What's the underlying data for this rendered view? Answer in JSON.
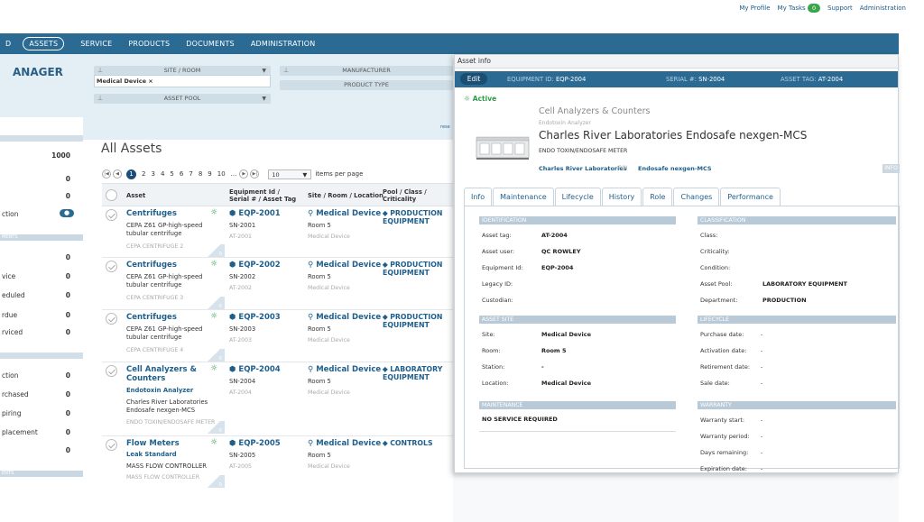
{
  "top_links": {
    "my_profile": "My Profile",
    "my_tasks": "My Tasks",
    "tasks_count": "0",
    "support": "Support",
    "administration": "Administration"
  },
  "nav": {
    "partial": "D",
    "assets": "ASSETS",
    "service": "SERVICE",
    "products": "PRODUCTS",
    "documents": "DOCUMENTS",
    "administration": "ADMINISTRATION"
  },
  "sidebar": {
    "brand": "ANAGER",
    "total": "1000",
    "rows": [
      {
        "label": "",
        "count": "0"
      },
      {
        "label": "",
        "count": "0"
      },
      {
        "label": "ction",
        "count": ""
      },
      {
        "label": "",
        "count": "0"
      },
      {
        "label": "vice",
        "count": "0"
      },
      {
        "label": "eduled",
        "count": "0"
      },
      {
        "label": "rdue",
        "count": "0"
      },
      {
        "label": "rviced",
        "count": "0"
      },
      {
        "label": "ction",
        "count": "0"
      },
      {
        "label": "rchased",
        "count": "0"
      },
      {
        "label": "piring",
        "count": "0"
      },
      {
        "label": "placement",
        "count": "0"
      },
      {
        "label": "",
        "count": "0"
      }
    ],
    "section1": "MENTS",
    "section2": "ENTS"
  },
  "filters": {
    "site_room": "SITE / ROOM",
    "site_room_value": "Medical Device ×",
    "manufacturer": "MANUFACTURER",
    "product_type": "PRODUCT TYPE",
    "asset_pool": "ASSET POOL",
    "partial": "rese"
  },
  "page_title": "All Assets",
  "pager": {
    "pages": [
      "2",
      "3",
      "4",
      "5",
      "6",
      "7",
      "8",
      "9",
      "10",
      "..."
    ],
    "current": "1",
    "per_page": "10",
    "items_label": "items per page"
  },
  "table": {
    "headers": {
      "asset": "Asset",
      "eq": "Equipment Id / Serial # / Asset Tag",
      "site": "Site / Room / Location",
      "pool": "Pool / Class / Criticality"
    },
    "rows": [
      {
        "name": "Centrifuges",
        "desc": "CEPA Z61 GP-high-speed tubular centrifuge",
        "sub_blue": "",
        "desc2": "",
        "grey": "CEPA CENTRIFUGE 2",
        "corner": "0",
        "eq": "EQP-2001",
        "sn": "SN-2001",
        "at": "AT-2001",
        "site": "Medical Device",
        "room": "Room 5",
        "loc": "Medical Device",
        "pool": "PRODUCTION EQUIPMENT"
      },
      {
        "name": "Centrifuges",
        "desc": "CEPA Z61 GP-high-speed tubular centrifuge",
        "sub_blue": "",
        "desc2": "",
        "grey": "CEPA CENTRIFUGE 3",
        "corner": "0",
        "eq": "EQP-2002",
        "sn": "SN-2002",
        "at": "AT-2002",
        "site": "Medical Device",
        "room": "Room 5",
        "loc": "Medical Device",
        "pool": "PRODUCTION EQUIPMENT"
      },
      {
        "name": "Centrifuges",
        "desc": "CEPA Z61 GP-high-speed tubular centrifuge",
        "sub_blue": "",
        "desc2": "",
        "grey": "CEPA CENTRIFUGE 4",
        "corner": "0",
        "eq": "EQP-2003",
        "sn": "SN-2003",
        "at": "AT-2003",
        "site": "Medical Device",
        "room": "Room 5",
        "loc": "Medical Device",
        "pool": "PRODUCTION EQUIPMENT"
      },
      {
        "name": "Cell Analyzers & Counters",
        "desc": "",
        "sub_blue": "Endotoxin Analyzer",
        "desc2": "Charles River Laboratories Endosafe nexgen-MCS",
        "grey": "ENDO TOXIN/ENDOSAFE METER",
        "corner": "0",
        "eq": "EQP-2004",
        "sn": "SN-2004",
        "at": "AT-2004",
        "site": "Medical Device",
        "room": "Room 5",
        "loc": "Medical Device",
        "pool": "LABORATORY EQUIPMENT"
      },
      {
        "name": "Flow Meters",
        "desc": "",
        "sub_blue": "Leak Standard",
        "desc2": "MASS FLOW CONTROLLER",
        "grey": "MASS FLOW CONTROLLER",
        "corner": "0",
        "eq": "EQP-2005",
        "sn": "SN-2005",
        "at": "AT-2005",
        "site": "Medical Device",
        "room": "Room 5",
        "loc": "Medical Device",
        "pool": "CONTROLS"
      }
    ]
  },
  "modal": {
    "title": "Asset info",
    "edit": "Edit",
    "equipment_id_label": "EQUIPMENT ID:",
    "equipment_id": "EQP-2004",
    "serial_label": "SERIAL #:",
    "serial": "SN-2004",
    "asset_tag_label": "ASSET TAG:",
    "asset_tag": "AT-2004",
    "status": "Active",
    "category": "Cell Analyzers & Counters",
    "subcategory": "Endotoxin Analyzer",
    "model": "Charles River Laboratories Endosafe nexgen-MCS",
    "model_type": "ENDO TOXIN/ENDOSAFE METER",
    "manufacturer": "Charles River Laboratories",
    "pn_label": "P/N",
    "pn_value": "Endosafe nexgen-MCS",
    "info_btn": "INFO",
    "tabs": [
      "Info",
      "Maintenance",
      "Lifecycle",
      "History",
      "Role",
      "Changes",
      "Performance"
    ],
    "identification": {
      "head": "IDENTIFICATION",
      "rows": [
        {
          "label": "Asset tag:",
          "value": "AT-2004"
        },
        {
          "label": "Asset user:",
          "value": "QC ROWLEY"
        },
        {
          "label": "Equipment Id:",
          "value": "EQP-2004"
        },
        {
          "label": "Legacy ID:",
          "value": ""
        },
        {
          "label": "Custodian:",
          "value": ""
        }
      ]
    },
    "classification": {
      "head": "CLASSIFICATION",
      "rows": [
        {
          "label": "Class:",
          "value": ""
        },
        {
          "label": "Criticality:",
          "value": ""
        },
        {
          "label": "Condition:",
          "value": ""
        },
        {
          "label": "Asset Pool:",
          "value": "LABORATORY EQUIPMENT"
        },
        {
          "label": "Department:",
          "value": "PRODUCTION"
        }
      ]
    },
    "asset_site": {
      "head": "ASSET SITE",
      "rows": [
        {
          "label": "Site:",
          "value": "Medical Device"
        },
        {
          "label": "Room:",
          "value": "Room 5"
        },
        {
          "label": "Station:",
          "value": "-"
        },
        {
          "label": "Location:",
          "value": "Medical Device"
        }
      ]
    },
    "lifecycle": {
      "head": "LIFECYCLE",
      "rows": [
        {
          "label": "Purchase date:",
          "value": "-"
        },
        {
          "label": "Activation date:",
          "value": "-"
        },
        {
          "label": "Retirement date:",
          "value": "-"
        },
        {
          "label": "Sale date:",
          "value": "-"
        }
      ]
    },
    "maintenance": {
      "head": "MAINTENANCE",
      "value": "NO SERVICE REQUIRED"
    },
    "warranty": {
      "head": "WARRANTY",
      "rows": [
        {
          "label": "Warranty start:",
          "value": "-"
        },
        {
          "label": "Warranty period:",
          "value": "-"
        },
        {
          "label": "Days remaining:",
          "value": "-"
        },
        {
          "label": "Expiration date:",
          "value": "-"
        }
      ]
    }
  }
}
